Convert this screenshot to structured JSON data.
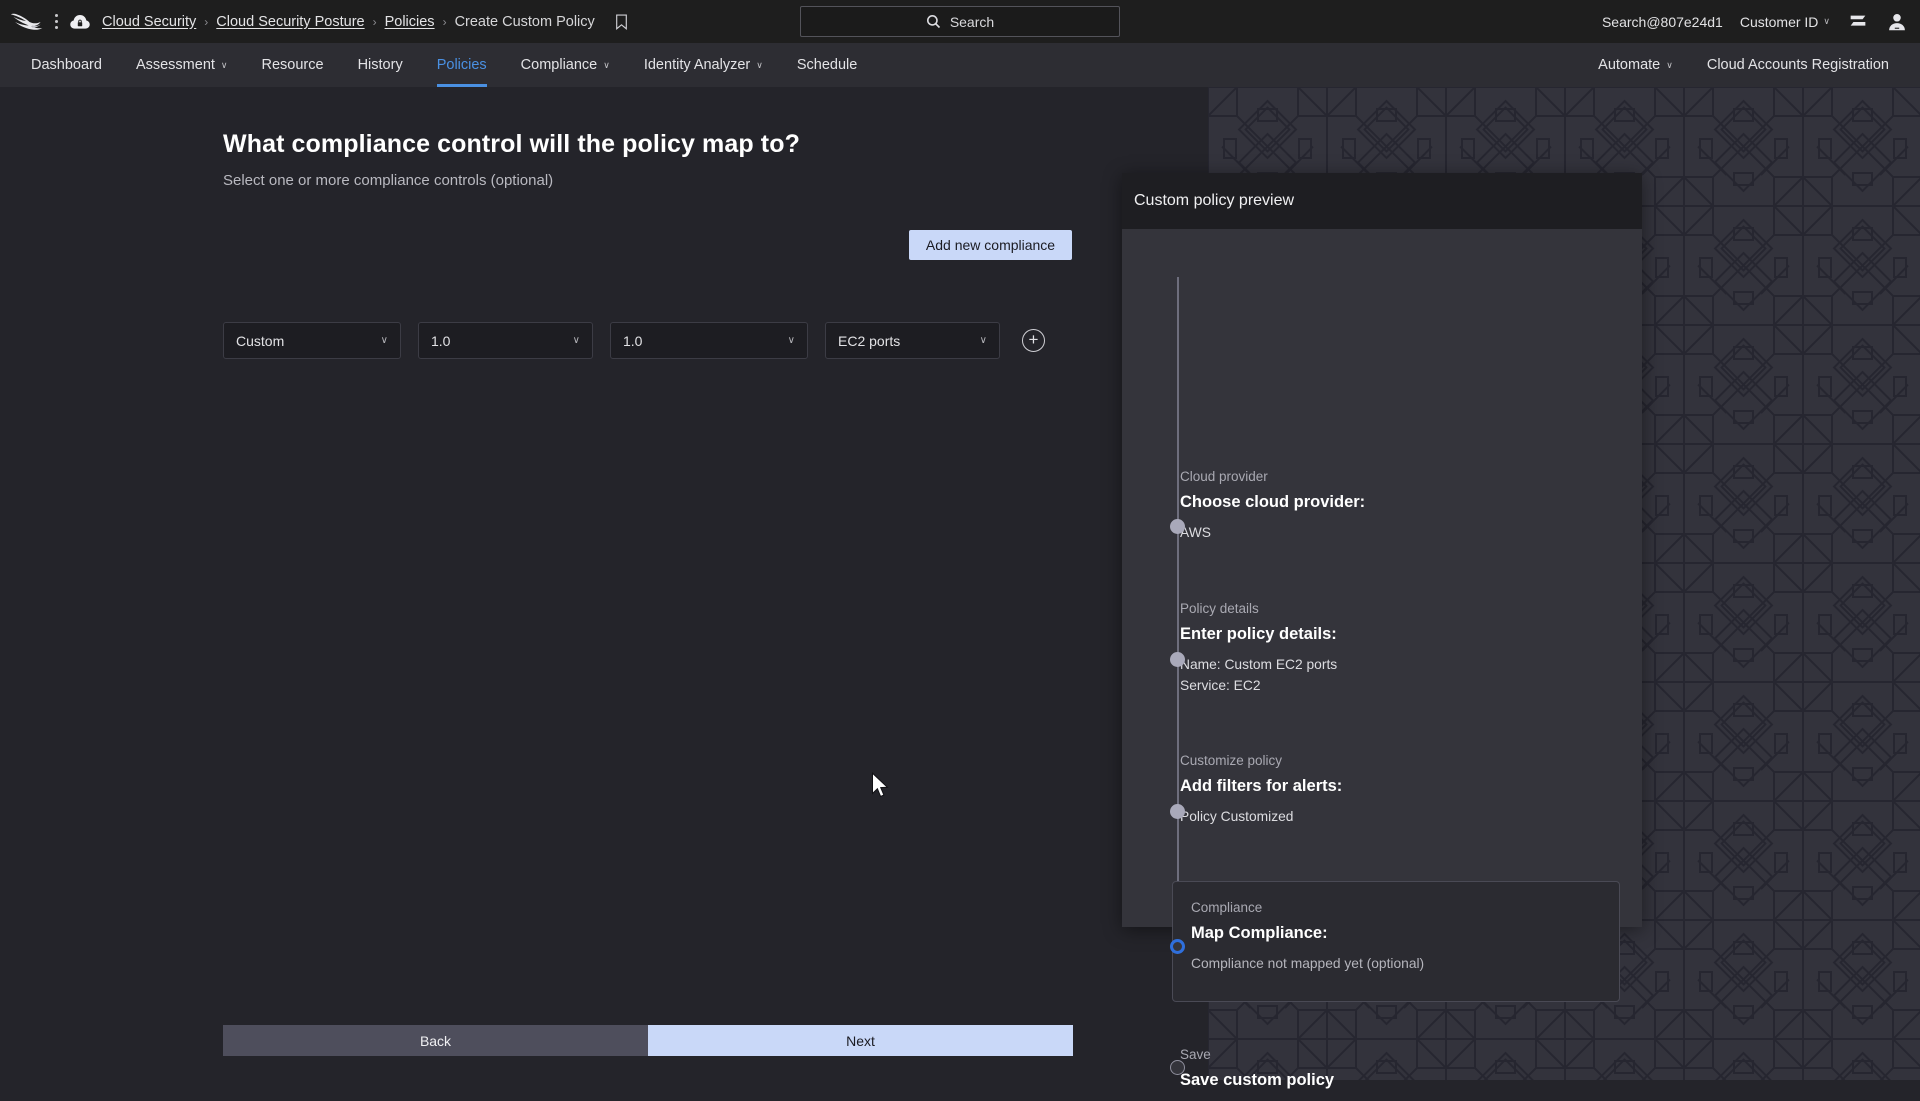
{
  "topbar": {
    "breadcrumb": [
      {
        "label": "Cloud Security",
        "link": true
      },
      {
        "label": "Cloud Security Posture",
        "link": true
      },
      {
        "label": "Policies",
        "link": true
      },
      {
        "label": "Create Custom Policy",
        "link": false
      }
    ],
    "separator": "›",
    "search": {
      "label": "Search",
      "icon": "search-icon"
    },
    "account": "Search@807e24d1",
    "customer_id": "Customer ID",
    "chevron": "∨",
    "icons": [
      "falcon-logo-icon",
      "kebab-menu-icon",
      "cloud-lock-icon",
      "bookmark-icon",
      "feedback-icon",
      "user-avatar-icon"
    ]
  },
  "nav": {
    "left_items": [
      {
        "label": "Dashboard",
        "dropdown": false,
        "active": false
      },
      {
        "label": "Assessment",
        "dropdown": true,
        "active": false
      },
      {
        "label": "Resource",
        "dropdown": false,
        "active": false
      },
      {
        "label": "History",
        "dropdown": false,
        "active": false
      },
      {
        "label": "Policies",
        "dropdown": false,
        "active": true
      },
      {
        "label": "Compliance",
        "dropdown": true,
        "active": false
      },
      {
        "label": "Identity Analyzer",
        "dropdown": true,
        "active": false
      },
      {
        "label": "Schedule",
        "dropdown": false,
        "active": false
      }
    ],
    "right_items": [
      {
        "label": "Automate",
        "dropdown": true
      },
      {
        "label": "Cloud Accounts Registration",
        "dropdown": false
      }
    ],
    "chevron": "∨",
    "active_color": "#4a90e2"
  },
  "main": {
    "title": "What compliance control will the policy map to?",
    "subtitle": "Select one or more compliance controls (optional)",
    "add_compliance_button": "Add new compliance",
    "selects": [
      {
        "name": "framework",
        "value": "Custom",
        "width": "sel-w1"
      },
      {
        "name": "version",
        "value": "1.0",
        "width": "sel-w2"
      },
      {
        "name": "section",
        "value": "1.0",
        "width": "sel-w3"
      },
      {
        "name": "control",
        "value": "EC2 ports",
        "width": "sel-w4"
      }
    ],
    "select_chevron": "∨",
    "add_row_button": "+",
    "footer": {
      "back": "Back",
      "next": "Next",
      "back_color": "#4e4e5c",
      "next_color": "#c9d8f8"
    }
  },
  "preview": {
    "title": "Custom policy preview",
    "steps": [
      {
        "kicker": "Cloud provider",
        "title": "Choose cloud provider:",
        "body": "AWS",
        "state": "done"
      },
      {
        "kicker": "Policy details",
        "title": "Enter policy details:",
        "body": "Name: Custom EC2 ports\nService: EC2",
        "state": "done"
      },
      {
        "kicker": "Customize policy",
        "title": "Add filters for alerts:",
        "body": "Policy Customized",
        "state": "done"
      },
      {
        "kicker": "Compliance",
        "title": "Map Compliance:",
        "body": "Compliance not mapped yet (optional)",
        "state": "current"
      },
      {
        "kicker": "Save",
        "title": "Save custom policy",
        "body": "",
        "state": "todo"
      }
    ],
    "current_dot_color": "#2f6fdc",
    "done_dot_color": "#a9a9ba"
  }
}
